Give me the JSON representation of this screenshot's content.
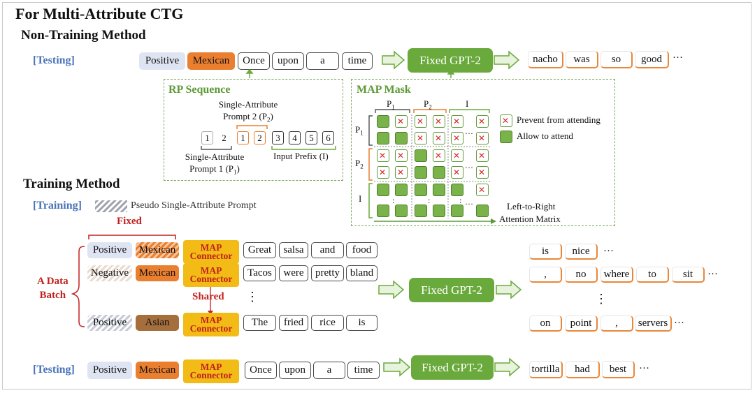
{
  "title": "For Multi-Attribute CTG",
  "non_training": {
    "heading": "Non-Training Method",
    "testing_label": "[Testing]",
    "attrs": [
      "Positive",
      "Mexican"
    ],
    "input_tokens": [
      "Once",
      "upon",
      "a",
      "time"
    ],
    "model": "Fixed GPT-2",
    "output_tokens": [
      "nacho",
      "was",
      "so",
      "good"
    ],
    "ellipsis": "···"
  },
  "rp_sequence": {
    "title": "RP Sequence",
    "p2_label": "Single-Attribute Prompt 2 (P",
    "p2_sub": "2",
    "p2_end": ")",
    "nums": [
      "1",
      "2",
      "1",
      "2",
      "3",
      "4",
      "5",
      "6"
    ],
    "p1_label": "Single-Attribute Prompt 1 (P",
    "p1_sub": "1",
    "p1_end": ")",
    "input_prefix": "Input Prefix (I)"
  },
  "map_mask": {
    "title": "MAP Mask",
    "col_labels": [
      "P",
      "P",
      "I"
    ],
    "col_subs": [
      "1",
      "2",
      ""
    ],
    "row_labels": [
      "P",
      "P",
      "I"
    ],
    "row_subs": [
      "1",
      "2",
      ""
    ],
    "legend_prevent": "Prevent from attending",
    "legend_allow": "Allow to attend",
    "matrix_label_1": "Left-to-Right",
    "matrix_label_2": "Attention Matrix",
    "dots": "···",
    "vdots": ":"
  },
  "training": {
    "heading": "Training Method",
    "training_label": "[Training]",
    "pseudo_label": "Pseudo Single-Attribute Prompt",
    "fixed_label": "Fixed",
    "shared_label": "Shared",
    "batch_label_1": "A Data",
    "batch_label_2": "Batch",
    "connector_1": "MAP",
    "connector_2": "Connector",
    "model": "Fixed GPT-2",
    "vdots": "⋮",
    "rows": [
      {
        "attrs": [
          "Positive",
          "Mexican"
        ],
        "input": [
          "Great",
          "salsa",
          "and",
          "food"
        ],
        "output": [
          "is",
          "nice"
        ]
      },
      {
        "attrs": [
          "Negative",
          "Mexican"
        ],
        "input": [
          "Tacos",
          "were",
          "pretty",
          "bland"
        ],
        "output": [
          ",",
          "no",
          "where",
          "to",
          "sit"
        ]
      },
      {
        "attrs": [
          "Positive",
          "Asian"
        ],
        "input": [
          "The",
          "fried",
          "rice",
          "is"
        ],
        "output": [
          "on",
          "point",
          ",",
          "servers"
        ]
      }
    ],
    "ellipsis": "···"
  },
  "testing2": {
    "label": "[Testing]",
    "attrs": [
      "Positive",
      "Mexican"
    ],
    "input": [
      "Once",
      "upon",
      "a",
      "time"
    ],
    "model": "Fixed GPT-2",
    "output": [
      "tortilla",
      "had",
      "best"
    ],
    "ellipsis": "···"
  },
  "colors": {
    "green": "#6aaa3c",
    "orange": "#ea7f30",
    "blue_label": "#4a73b8",
    "red_label": "#c0211e",
    "connector": "#f2bb16"
  }
}
